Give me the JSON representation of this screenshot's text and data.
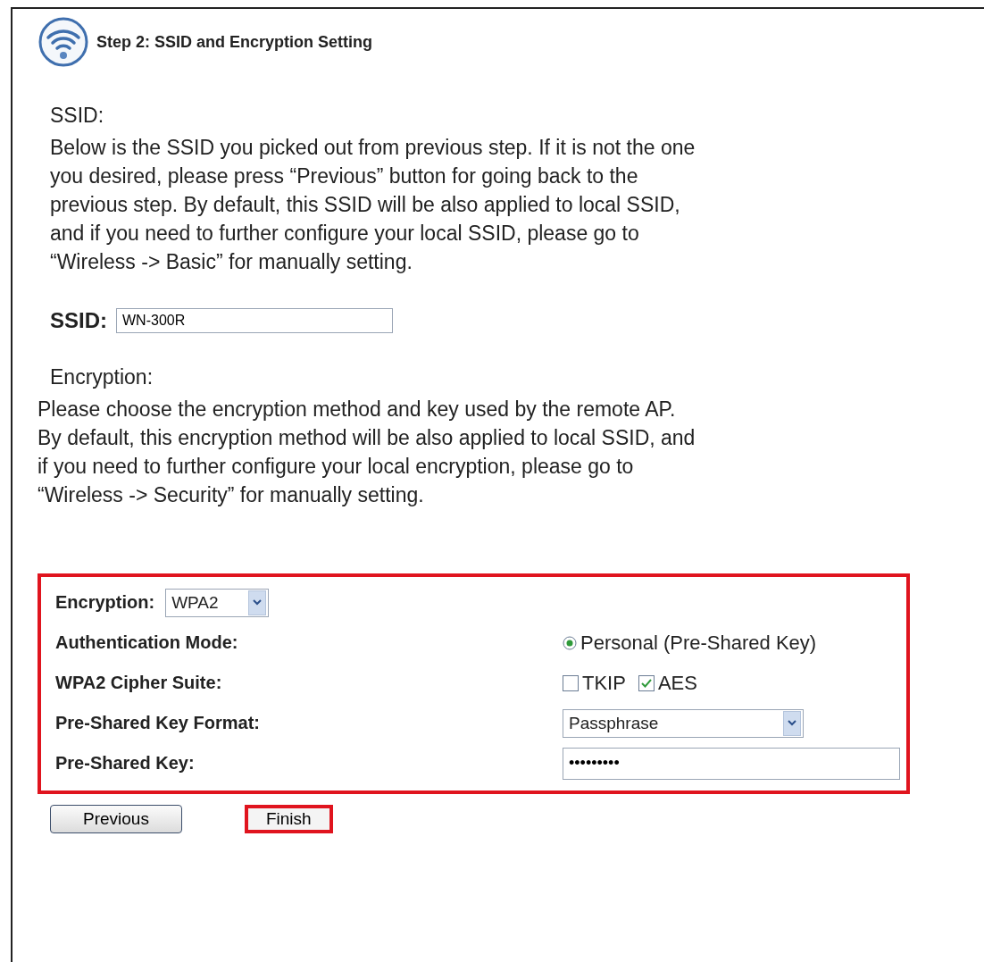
{
  "header": {
    "title": "Step 2: SSID and Encryption Setting"
  },
  "ssid_section": {
    "heading": "SSID:",
    "text": "Below is the SSID you picked out from previous step. If it is not the one\nyou desired, please press “Previous” button for going back to the\nprevious step. By default, this SSID will be also applied to local SSID,\nand if you need to further configure your local SSID, please go to\n“Wireless -> Basic” for manually setting.",
    "label": "SSID:",
    "value": "WN-300R"
  },
  "encryption_section": {
    "heading": "Encryption:",
    "text": "Please choose the encryption method and key used by the remote AP.\nBy default, this encryption method will be also applied to local SSID, and\nif you need to further configure your local encryption, please go to\n“Wireless -> Security” for manually setting."
  },
  "form": {
    "highlighted": true,
    "encryption": {
      "label": "Encryption:",
      "value": "WPA2"
    },
    "rows": [
      {
        "kind": "radio",
        "label": "Authentication Mode:",
        "options": [
          {
            "label": "Personal (Pre-Shared Key)",
            "selected": true
          }
        ]
      },
      {
        "kind": "checkbox",
        "label": "WPA2 Cipher Suite:",
        "options": [
          {
            "label": "TKIP",
            "checked": false
          },
          {
            "label": "AES",
            "checked": true
          }
        ]
      },
      {
        "kind": "select",
        "label": "Pre-Shared Key Format:",
        "value": "Passphrase"
      },
      {
        "kind": "input",
        "label": "Pre-Shared Key:",
        "value": "•••••••••"
      }
    ]
  },
  "buttons": [
    {
      "label": "Previous",
      "highlighted": false
    },
    {
      "label": "Finish",
      "highlighted": true
    }
  ]
}
